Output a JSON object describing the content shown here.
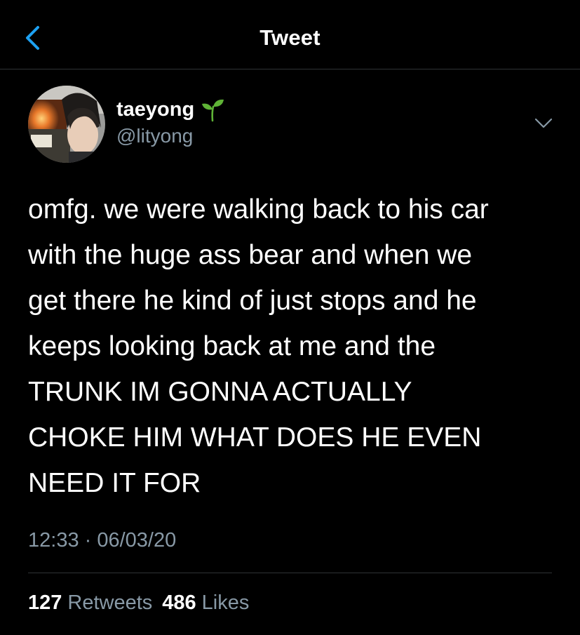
{
  "header": {
    "title": "Tweet",
    "back_icon": "chevron-left-icon"
  },
  "colors": {
    "background": "#000000",
    "accent": "#1da1f2",
    "secondary_text": "#8899a6",
    "divider": "#2f3336",
    "sprout": "#5fb336"
  },
  "author": {
    "display_name": "taeyong",
    "emoji_icon": "seedling-icon",
    "handle": "@lityong"
  },
  "tweet": {
    "text": "omfg. we were walking back to his car\nwith the huge ass bear and when we\nget there he kind of just stops and he\nkeeps looking back at me and the\nTRUNK IM GONNA ACTUALLY\nCHOKE HIM WHAT DOES HE EVEN\nNEED IT FOR",
    "timestamp": "12:33 · 06/03/20"
  },
  "stats": {
    "retweets_count": "127",
    "retweets_label": "Retweets",
    "likes_count": "486",
    "likes_label": "Likes"
  }
}
